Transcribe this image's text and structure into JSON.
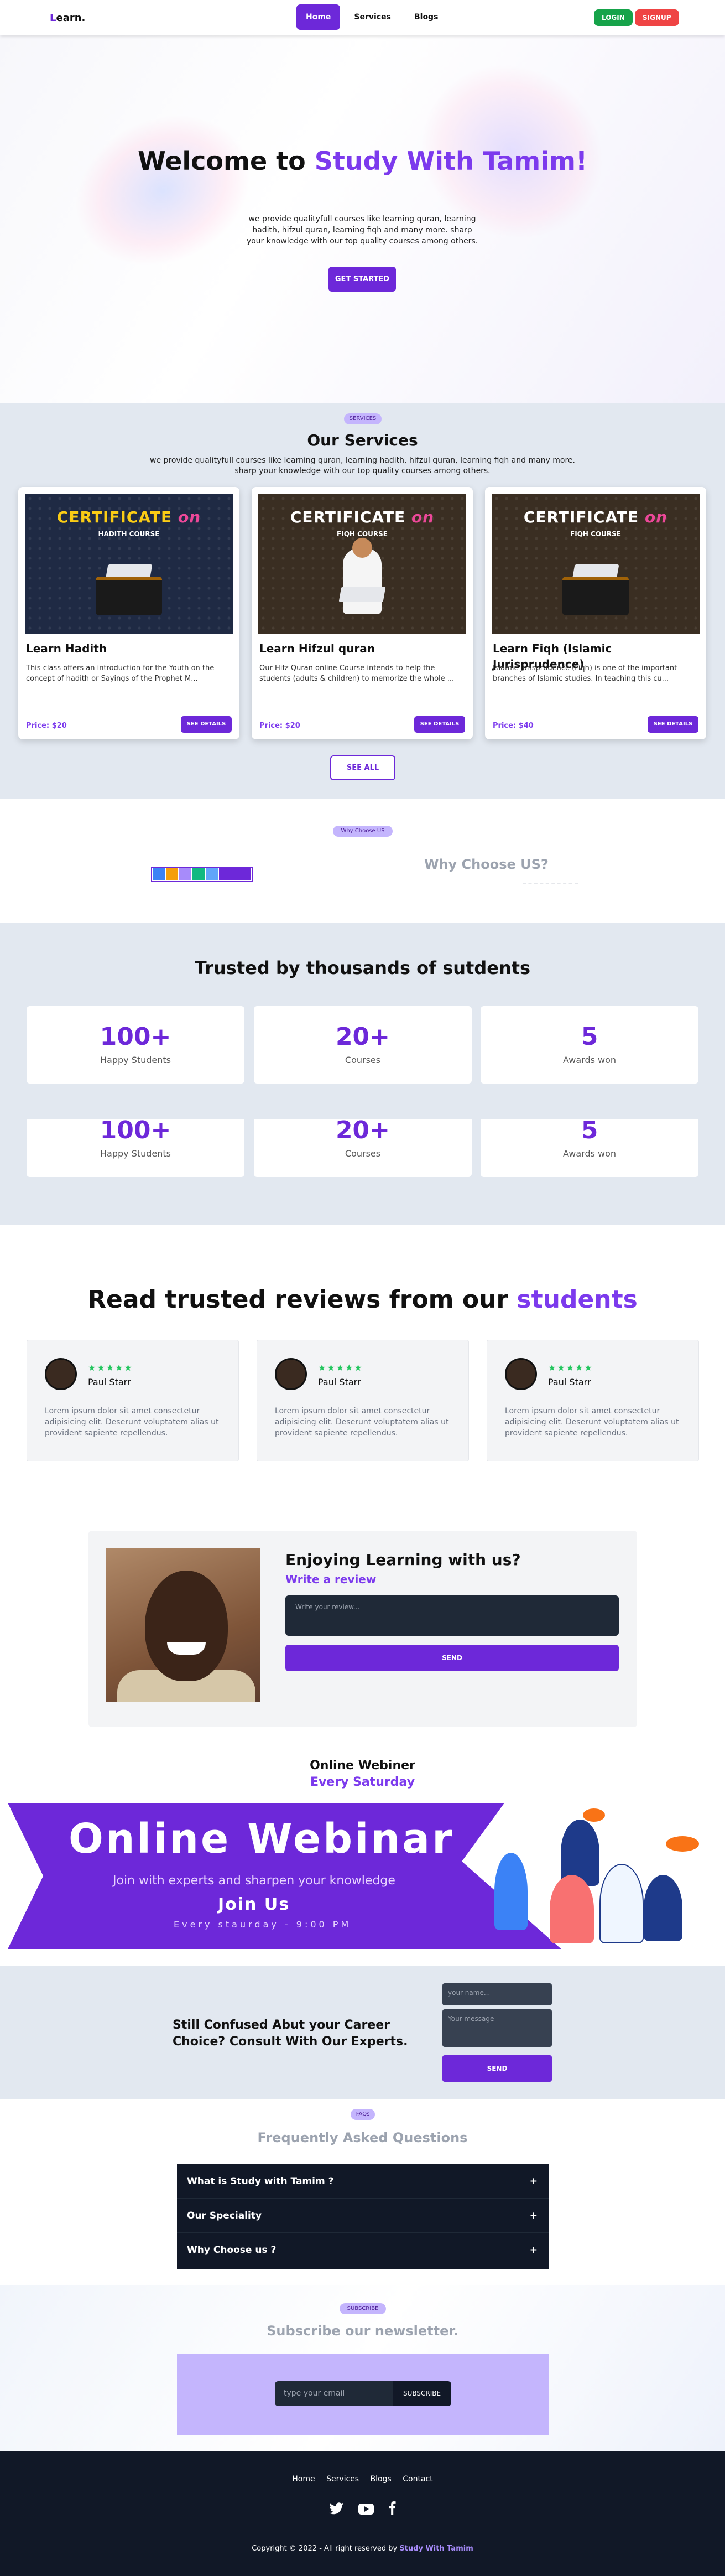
{
  "nav": {
    "logo_first": "L",
    "logo_rest": "earn.",
    "links": [
      "Home",
      "Services",
      "Blogs"
    ],
    "login": "LOGIN",
    "signup": "SIGNUP"
  },
  "hero": {
    "title_plain": "Welcome to ",
    "title_accent": "Study With Tamim!",
    "description": "we provide qualityfull courses like learning quran, learning hadith, hifzul quran, learning fiqh and many more. sharp your knowledge with our top quality courses among others.",
    "cta": "GET STARTED"
  },
  "services": {
    "badge": "SERVICES",
    "title": "Our Services",
    "subtitle_1": "we provide qualityfull courses like learning quran, learning hadith, hifzul quran, learning fiqh and many more.",
    "subtitle_2": "sharp your knowledge with our top quality courses among others.",
    "cards": [
      {
        "img_title": "CERTIFICATE",
        "img_on": "on",
        "img_sub": "HADITH COURSE",
        "title": "Learn Hadith",
        "desc": "This class offers an introduction for the Youth on the concept of hadith or Sayings of the Prophet M...",
        "price": "Price: $20",
        "button": "SEE DETAILS"
      },
      {
        "img_title": "CERTIFICATE",
        "img_on": "on",
        "img_sub": "FIQH COURSE",
        "title": "Learn Hifzul quran",
        "desc": "Our Hifz Quran online Course intends to help the students (adults & children) to memorize the whole ...",
        "price": "Price: $20",
        "button": "SEE DETAILS"
      },
      {
        "img_title": "CERTIFICATE",
        "img_on": "on",
        "img_sub": "FIQH COURSE",
        "title": "Learn Fiqh (Islamic Jurisprudence)",
        "desc": "Islamic Jurisprudence (Fiqh) is one of the important branches of Islamic studies. In teaching this cu...",
        "price": "Price: $40",
        "button": "SEE DETAILS"
      }
    ],
    "see_all": "SEE ALL"
  },
  "why": {
    "badge": "Why Choose US",
    "title": "Why Choose US?"
  },
  "trusted": {
    "title": "Trusted by thousands of sutdents",
    "stats": [
      {
        "number": "100+",
        "label": "Happy Students"
      },
      {
        "number": "20+",
        "label": "Courses"
      },
      {
        "number": "5",
        "label": "Awards won"
      }
    ]
  },
  "reviews": {
    "title_plain": "Read trusted reviews from our ",
    "title_accent": "students",
    "stars": "★★★★★",
    "items": [
      {
        "name": "Paul Starr",
        "text": "Lorem ipsum dolor sit amet consectetur adipisicing elit. Deserunt voluptatem alias ut provident sapiente repellendus."
      },
      {
        "name": "Paul Starr",
        "text": "Lorem ipsum dolor sit amet consectetur adipisicing elit. Deserunt voluptatem alias ut provident sapiente repellendus."
      },
      {
        "name": "Paul Starr",
        "text": "Lorem ipsum dolor sit amet consectetur adipisicing elit. Deserunt voluptatem alias ut provident sapiente repellendus."
      }
    ],
    "form": {
      "title": "Enjoying Learning with us?",
      "subtitle": "Write a review",
      "placeholder": "Write your review...",
      "send": "SEND"
    }
  },
  "webinar": {
    "title": "Online Webiner",
    "subtitle": "Every Saturday",
    "banner_title": "Online Webinar",
    "banner_sub": "Join with experts and sharpen your knowledge",
    "banner_join": "Join Us",
    "banner_time": "Every staurday - 9:00 PM"
  },
  "consult": {
    "title": "Still Confused Abut your Career Choice? Consult With Our Experts.",
    "name_placeholder": "your name...",
    "message_placeholder": "Your message",
    "send": "SEND"
  },
  "faq": {
    "badge": "FAQs",
    "title": "Frequently Asked Questions",
    "items": [
      "What is Study with Tamim ?",
      "Our Speciality",
      "Why Choose us ?"
    ],
    "toggle": "+"
  },
  "newsletter": {
    "badge": "SUBSCRIBE",
    "title": "Subscribe our newsletter.",
    "placeholder": "type your email",
    "button": "SUBSCRIBE"
  },
  "footer": {
    "links": [
      "Home",
      "Services",
      "Blogs",
      "Contact"
    ],
    "social_icons": [
      "twitter-icon",
      "youtube-icon",
      "facebook-icon"
    ],
    "copyright": "Copyright © 2022 - All right reserved by ",
    "brand": "Study With Tamim"
  },
  "colors": {
    "primary": "#6d28d9",
    "accent": "#7c3aed",
    "login": "#16a34a",
    "signup": "#ef4444",
    "dark": "#111827"
  }
}
